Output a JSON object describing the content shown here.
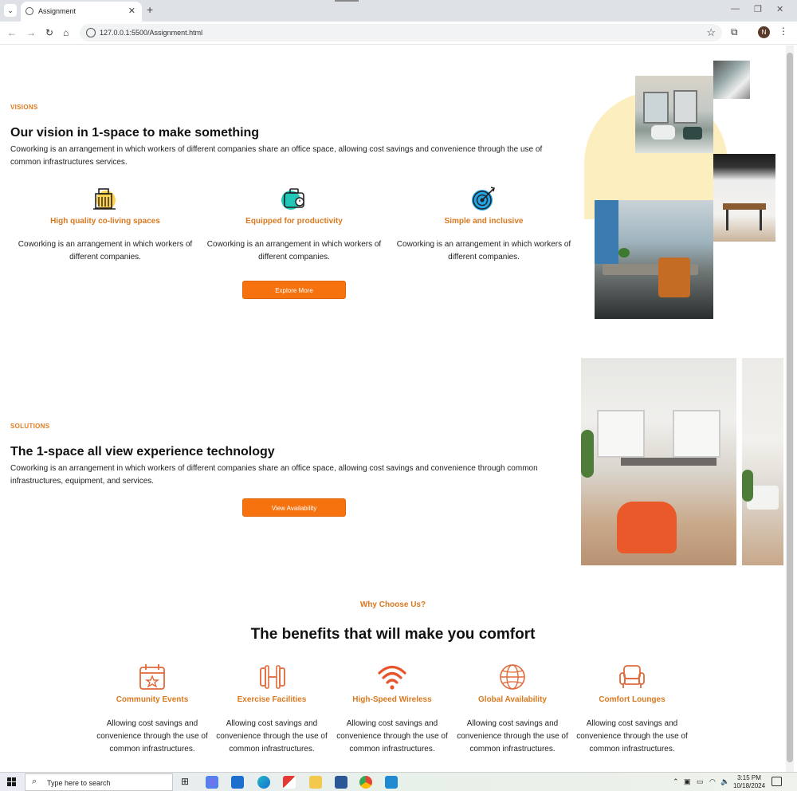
{
  "browser": {
    "tab_title": "Assignment",
    "url": "127.0.0.1:5500/Assignment.html",
    "profile_initial": "N"
  },
  "visions": {
    "eyebrow": "VISIONS",
    "heading": "Our vision in 1-space to make something",
    "paragraph": "Coworking is an arrangement in which workers of different companies share an office space, allowing cost savings and convenience through the use of common infrastructures services.",
    "features": [
      {
        "icon": "building-icon",
        "title": "High quality co-living spaces",
        "desc": "Coworking is an arrangement in which workers of different companies."
      },
      {
        "icon": "briefcase-icon",
        "title": "Equipped for productivity",
        "desc": "Coworking is an arrangement in which workers of different companies."
      },
      {
        "icon": "target-icon",
        "title": "Simple and inclusive",
        "desc": "Coworking is an arrangement in which workers of different companies."
      }
    ],
    "button": "Explore More"
  },
  "solutions": {
    "eyebrow": "SOLUTIONS",
    "heading": "The 1-space all view experience technology",
    "paragraph": "Coworking is an arrangement in which workers of different companies share an office space, allowing cost savings and convenience through common infrastructures, equipment, and services.",
    "button": "View Availability"
  },
  "benefits": {
    "eyebrow": "Why Choose Us?",
    "heading": "The benefits that will make you comfort",
    "items": [
      {
        "icon": "calendar-icon",
        "title": "Community Events",
        "desc": "Allowing cost savings and convenience through the use of common infrastructures."
      },
      {
        "icon": "dumbbell-icon",
        "title": "Exercise Facilities",
        "desc": "Allowing cost savings and convenience through the use of common infrastructures."
      },
      {
        "icon": "wifi-icon",
        "title": "High-Speed Wireless",
        "desc": "Allowing cost savings and convenience through the use of common infrastructures."
      },
      {
        "icon": "globe-icon",
        "title": "Global Availability",
        "desc": "Allowing cost savings and convenience through the use of common infrastructures."
      },
      {
        "icon": "armchair-icon",
        "title": "Comfort Lounges",
        "desc": "Allowing cost savings and convenience through the use of common infrastructures."
      }
    ]
  },
  "taskbar": {
    "search_placeholder": "Type here to search",
    "time": "3:15 PM",
    "date": "10/18/2024"
  },
  "colors": {
    "accent": "#f5720f",
    "accent_text": "#d9791f",
    "blob": "#fdeec0"
  }
}
